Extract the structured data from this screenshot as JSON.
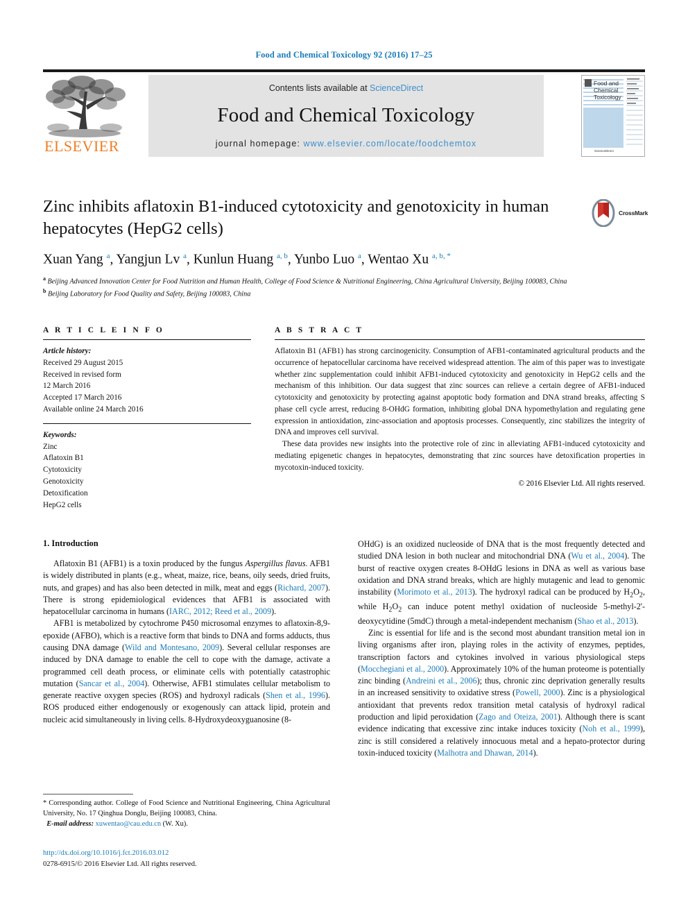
{
  "running_head": "Food and Chemical Toxicology 92 (2016) 17–25",
  "masthead": {
    "contents_prefix": "Contents lists available at ",
    "contents_link": "ScienceDirect",
    "journal_title": "Food and Chemical Toxicology",
    "homepage_prefix": "journal homepage: ",
    "homepage_url": "www.elsevier.com/locate/foodchemtox",
    "publisher": "ELSEVIER",
    "cover_title_line1": "Food and",
    "cover_title_line2": "Chemical",
    "cover_title_line3": "Toxicology",
    "link_color": "#3a8ecc",
    "band_color": "#e3e3e3",
    "elsevier_orange": "#ee7f25"
  },
  "crossmark": {
    "label": "CrossMark"
  },
  "article": {
    "title": "Zinc inhibits aflatoxin B1-induced cytotoxicity and genotoxicity in human hepatocytes (HepG2 cells)",
    "authors_html": "Xuan Yang <sup>a</sup>, Yangjun Lv <sup>a</sup>, Kunlun Huang <sup>a, b</sup>, Yunbo Luo <sup>a</sup>, Wentao Xu <sup>a, b, *</sup>",
    "affiliation_a": "Beijing Advanced Innovation Center for Food Nutrition and Human Health, College of Food Science & Nutritional Engineering, China Agricultural University, Beijing 100083, China",
    "affiliation_b": "Beijing Laboratory for Food Quality and Safety, Beijing 100083, China"
  },
  "article_info": {
    "heading": "A R T I C L E  I N F O",
    "history_label": "Article history:",
    "history": [
      "Received 29 August 2015",
      "Received in revised form",
      "12 March 2016",
      "Accepted 17 March 2016",
      "Available online 24 March 2016"
    ],
    "keywords_label": "Keywords:",
    "keywords": [
      "Zinc",
      "Aflatoxin B1",
      "Cytotoxicity",
      "Genotoxicity",
      "Detoxification",
      "HepG2 cells"
    ]
  },
  "abstract": {
    "heading": "A B S T R A C T",
    "paragraph1": "Aflatoxin B1 (AFB1) has strong carcinogenicity. Consumption of AFB1-contaminated agricultural products and the occurrence of hepatocellular carcinoma have received widespread attention. The aim of this paper was to investigate whether zinc supplementation could inhibit AFB1-induced cytotoxicity and genotoxicity in HepG2 cells and the mechanism of this inhibition. Our data suggest that zinc sources can relieve a certain degree of AFB1-induced cytotoxicity and genotoxicity by protecting against apoptotic body formation and DNA strand breaks, affecting S phase cell cycle arrest, reducing 8-OHdG formation, inhibiting global DNA hypomethylation and regulating gene expression in antioxidation, zinc-association and apoptosis processes. Consequently, zinc stabilizes the integrity of DNA and improves cell survival.",
    "paragraph2": "These data provides new insights into the protective role of zinc in alleviating AFB1-induced cytotoxicity and mediating epigenetic changes in hepatocytes, demonstrating that zinc sources have detoxification properties in mycotoxin-induced toxicity.",
    "copyright": "© 2016 Elsevier Ltd. All rights reserved."
  },
  "introduction": {
    "section_title": "1. Introduction",
    "left_paragraph_1_html": "Aflatoxin B1 (AFB1) is a toxin produced by the fungus <i>Aspergillus flavus</i>. AFB1 is widely distributed in plants (e.g., wheat, maize, rice, beans, oily seeds, dried fruits, nuts, and grapes) and has also been detected in milk, meat and eggs (<span class=\"ref\">Richard, 2007</span>). There is strong epidemiological evidences that AFB1 is associated with hepatocellular carcinoma in humans (<span class=\"ref\">IARC, 2012; Reed et al., 2009</span>).",
    "left_paragraph_2_html": "AFB1 is metabolized by cytochrome P450 microsomal enzymes to aflatoxin-8,9-epoxide (AFBO), which is a reactive form that binds to DNA and forms adducts, thus causing DNA damage (<span class=\"ref\">Wild and Montesano, 2009</span>). Several cellular responses are induced by DNA damage to enable the cell to cope with the damage, activate a programmed cell death process, or eliminate cells with potentially catastrophic mutation (<span class=\"ref\">Sancar et al., 2004</span>). Otherwise, AFB1 stimulates cellular metabolism to generate reactive oxygen species (ROS) and hydroxyl radicals (<span class=\"ref\">Shen et al., 1996</span>). ROS produced either endogenously or exogenously can attack lipid, protein and nucleic acid simultaneously in living cells. 8-Hydroxydeoxyguanosine (8-",
    "right_paragraph_1_html": "OHdG) is an oxidized nucleoside of DNA that is the most frequently detected and studied DNA lesion in both nuclear and mitochondrial DNA (<span class=\"ref\">Wu et al., 2004</span>). The burst of reactive oxygen creates 8-OHdG lesions in DNA as well as various base oxidation and DNA strand breaks, which are highly mutagenic and lead to genomic instability (<span class=\"ref\">Morimoto et al., 2013</span>). The hydroxyl radical can be produced by H<sub>2</sub>O<sub>2</sub>, while H<sub>2</sub>O<sub>2</sub> can induce potent methyl oxidation of nucleoside 5-methyl-2'-deoxycytidine (5mdC) through a metal-independent mechanism (<span class=\"ref\">Shao et al., 2013</span>).",
    "right_paragraph_2_html": "Zinc is essential for life and is the second most abundant transition metal ion in living organisms after iron, playing roles in the activity of enzymes, peptides, transcription factors and cytokines involved in various physiological steps (<span class=\"ref\">Mocchegiani et al., 2000</span>). Approximately 10% of the human proteome is potentially zinc binding (<span class=\"ref\">Andreini et al., 2006</span>); thus, chronic zinc deprivation generally results in an increased sensitivity to oxidative stress (<span class=\"ref\">Powell, 2000</span>). Zinc is a physiological antioxidant that prevents redox transition metal catalysis of hydroxyl radical production and lipid peroxidation (<span class=\"ref\">Zago and Oteiza, 2001</span>). Although there is scant evidence indicating that excessive zinc intake induces toxicity (<span class=\"ref\">Noh et al., 1999</span>), zinc is still considered a relatively innocuous metal and a hepato-protector during toxin-induced toxicity (<span class=\"ref\">Malhotra and Dhawan, 2014</span>)."
  },
  "footnotes": {
    "corresponding_html": "* Corresponding author. College of Food Science and Nutritional Engineering, China Agricultural University, No. 17 Qinghua Donglu, Beijing 100083, China.",
    "email_label": "E-mail address:",
    "email": "xuwentao@cau.edu.cn",
    "email_suffix": "(W. Xu).",
    "doi": "http://dx.doi.org/10.1016/j.fct.2016.03.012",
    "issn_line": "0278-6915/© 2016 Elsevier Ltd. All rights reserved."
  }
}
